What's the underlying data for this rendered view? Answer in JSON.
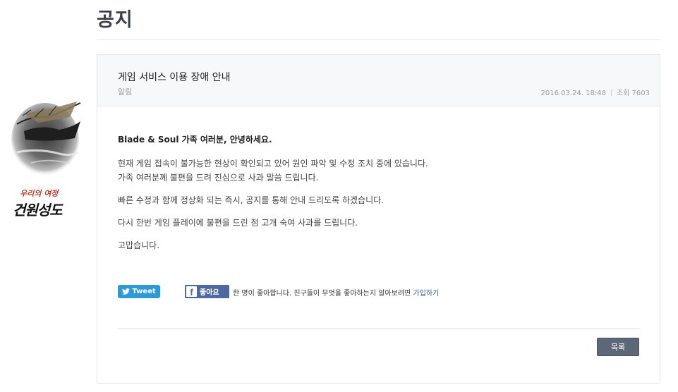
{
  "page": {
    "title": "공지"
  },
  "post": {
    "title": "게임 서비스 이용 장애 안내",
    "category": "알림",
    "date": "2016.03.24. 18:48",
    "views_label": "조회 7603",
    "greeting": "Blade & Soul 가족 여러분, 안녕하세요.",
    "paragraphs": [
      "현재 게임 접속이 불가능한 현상이 확인되고 있어 원인 파악 및 수정 조치 중에 있습니다.",
      "가족 여러분께 불편을 드려 진심으로 사과 말씀 드립니다.",
      "빠른 수정과 함께 정상화 되는 즉시, 공지를 통해 안내 드리도록 하겠습니다.",
      "다시 한번 게임 플레이에 불편을 드린 점 고개 숙여 사과를 드립니다.",
      "고맙습니다."
    ]
  },
  "side_art": {
    "caption_small": "우리의 여정",
    "caption_large": "건원성도"
  },
  "social": {
    "tweet_label": "Tweet",
    "fb_icon": "f",
    "fb_like_label": "좋아요",
    "fb_like_text": "한 명이 좋아합니다. 친구들이 무엇을 좋아하는지 알아보려면",
    "fb_signup_link": "가입하기"
  },
  "actions": {
    "list_button": "목록"
  },
  "colors": {
    "tweet": "#2b9bd8",
    "facebook": "#4e69a2",
    "list_button": "#5d6778",
    "art_caption_red": "#c0392b"
  }
}
